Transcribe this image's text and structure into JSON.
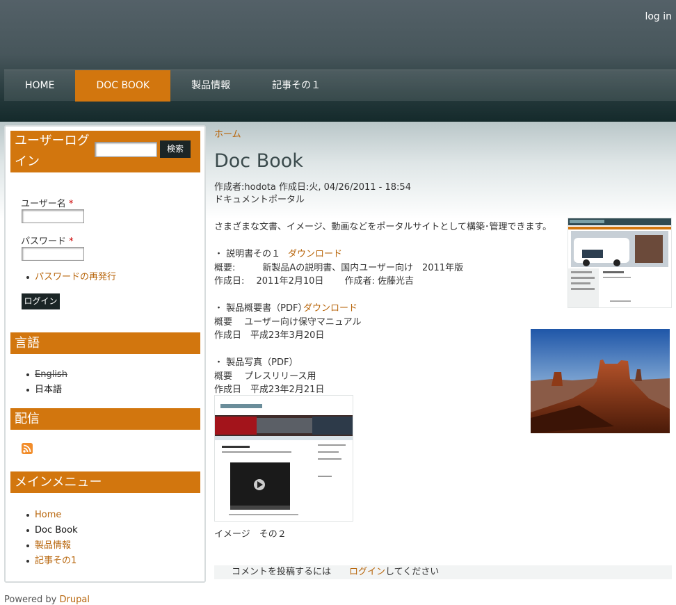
{
  "header": {
    "login_link": "log in",
    "nav": [
      "HOME",
      "DOC BOOK",
      "製品情報",
      "記事その１"
    ]
  },
  "sidebar": {
    "login_block_title": "ユーザーログイン",
    "search_button": "検索",
    "username_label": "ユーザー名",
    "password_label": "パスワード",
    "required_mark": "*",
    "reset_password_link": "パスワードの再発行",
    "login_button": "ログイン",
    "language_title": "言語",
    "languages": [
      "English",
      "日本語"
    ],
    "syndication_title": "配信",
    "menu_title": "メインメニュー",
    "menu_items": [
      "Home",
      "Doc Book",
      "製品情報",
      "記事その1"
    ]
  },
  "main": {
    "breadcrumb": "ホーム",
    "title": "Doc Book",
    "submitted": "作成者:hodota 作成日:火, 04/26/2011 - 18:54",
    "subtitle": "ドキュメントポータル",
    "intro": "さまざまな文書、イメージ、動画などをポータルサイトとして構築･管理できます。",
    "item1_title": "・ 説明書その１",
    "item1_download": "ダウンロード",
    "item1_summary": "概要:　　　新製品Aの説明書、国内ユーザー向け　2011年版",
    "item1_date": "作成日:　 2011年2月10日　　 作成者: 佐藤光吉",
    "item2_title": "・ 製品概要書（PDF）",
    "item2_download": "ダウンロード",
    "item2_summary": "概要　 ユーザー向け保守マニュアル",
    "item2_date": "作成日　平成23年3月20日",
    "item3_title": "・ 製品写真（PDF）",
    "item3_summary": "概要　 プレスリリース用",
    "item3_date": "作成日　平成23年2月21日",
    "image_caption": "イメージ　その２",
    "comment_prefix": "コメントを投稿するには　　",
    "comment_login_link": "ログイン",
    "comment_suffix": "してください"
  },
  "footer": {
    "powered_prefix": "Powered by",
    "powered_link": "Drupal"
  },
  "colors": {
    "accent": "#d2760e",
    "link": "#b8660c",
    "header_dark": "#142a2b"
  }
}
